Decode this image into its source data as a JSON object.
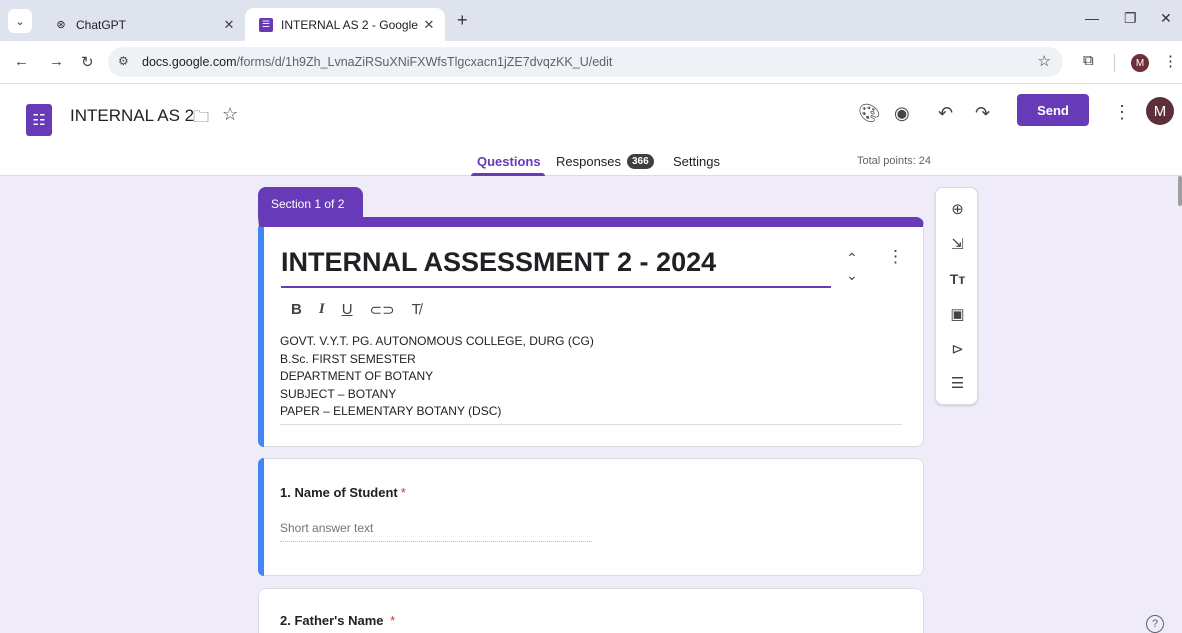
{
  "browser": {
    "tabs": [
      {
        "title": "ChatGPT",
        "favicon": "chatgpt-icon",
        "active": false
      },
      {
        "title": "INTERNAL AS 2 - Google Forms",
        "favicon": "forms-icon",
        "active": true
      }
    ],
    "new_tab": "+",
    "url_host": "docs.google.com",
    "url_path": "/forms/d/1h9Zh_LvnaZiRSuXNiFXWfsTlgcxacn1jZE7dvqzKK_U/edit",
    "profile_initial": "M"
  },
  "header": {
    "form_name": "INTERNAL AS 2",
    "send_label": "Send",
    "avatar_initial": "M",
    "tabs": [
      {
        "label": "Questions",
        "active": true
      },
      {
        "label": "Responses",
        "active": false,
        "badge": "366"
      },
      {
        "label": "Settings",
        "active": false
      }
    ],
    "total_points": "Total points: 24"
  },
  "section_label": "Section 1 of 2",
  "form": {
    "title": "INTERNAL ASSESSMENT 2 - 2024",
    "description": [
      "GOVT. V.Y.T. PG. AUTONOMOUS COLLEGE, DURG (CG)",
      "B.Sc. FIRST SEMESTER",
      "DEPARTMENT OF BOTANY",
      "SUBJECT – BOTANY",
      "PAPER – ELEMENTARY BOTANY  (DSC)"
    ],
    "format_buttons": [
      "B",
      "I",
      "U",
      "link",
      "clear"
    ]
  },
  "questions": [
    {
      "title": "1. Name of Student",
      "required": "*",
      "placeholder": "Short answer text"
    },
    {
      "title": "2. Father's Name",
      "required": "*"
    }
  ],
  "colors": {
    "accent": "#673ab7",
    "background": "#f0ebf8",
    "selected_bar": "#4285f4",
    "required": "#d93025"
  }
}
